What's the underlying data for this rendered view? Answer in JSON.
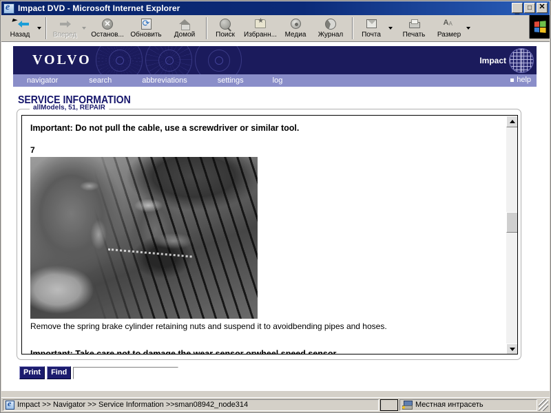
{
  "window": {
    "title": "Impact DVD - Microsoft Internet Explorer",
    "icon": "ie-icon",
    "minimize_label": "_",
    "maximize_label": "□",
    "close_label": "✕"
  },
  "toolbar": {
    "items": [
      {
        "label": "Назад",
        "icon": "back-arrow-icon",
        "disabled": false,
        "has_dropdown": true
      },
      {
        "label": "Вперед",
        "icon": "forward-arrow-icon",
        "disabled": true,
        "has_dropdown": true
      },
      {
        "label": "Останов...",
        "icon": "stop-icon",
        "disabled": false,
        "has_dropdown": false
      },
      {
        "label": "Обновить",
        "icon": "refresh-icon",
        "disabled": false,
        "has_dropdown": false
      },
      {
        "label": "Домой",
        "icon": "home-icon",
        "disabled": false,
        "has_dropdown": false
      },
      {
        "label": "Поиск",
        "icon": "search-icon",
        "disabled": false,
        "has_dropdown": false
      },
      {
        "label": "Избранн...",
        "icon": "favorites-icon",
        "disabled": false,
        "has_dropdown": false
      },
      {
        "label": "Медиа",
        "icon": "media-icon",
        "disabled": false,
        "has_dropdown": false
      },
      {
        "label": "Журнал",
        "icon": "history-icon",
        "disabled": false,
        "has_dropdown": false
      },
      {
        "label": "Почта",
        "icon": "mail-icon",
        "disabled": false,
        "has_dropdown": true
      },
      {
        "label": "Печать",
        "icon": "printer-icon",
        "disabled": false,
        "has_dropdown": false
      },
      {
        "label": "Размер",
        "icon": "font-size-icon",
        "disabled": false,
        "has_dropdown": true
      }
    ],
    "brand_logo": "windows-logo-icon"
  },
  "banner": {
    "logo_text": "VOLVO",
    "product_text": "Impact",
    "product_icon": "globe-grid-icon",
    "nav": [
      {
        "label": "navigator"
      },
      {
        "label": "search"
      },
      {
        "label": "abbreviations"
      },
      {
        "label": "settings"
      },
      {
        "label": "log"
      }
    ],
    "help_label": "help"
  },
  "page": {
    "title": "SERVICE INFORMATION",
    "breadcrumb_legend": "allModels, 51, REPAIR"
  },
  "content": {
    "important_top": "Important: Do not pull the cable, use a screwdriver or similar tool.",
    "step_number": "7",
    "photo_alt": "brake-cylinder-photo",
    "caption": "Remove the spring brake cylinder retaining nuts and suspend it to avoidbending pipes and hoses.",
    "important_bottom": "Important: Take care not to damage the wear sensor orwheel speed sensor."
  },
  "actions": {
    "print_label": "Print",
    "find_label": "Find",
    "find_value": "",
    "find_placeholder": ""
  },
  "statusbar": {
    "breadcrumb": "Impact >> Navigator >> Service Information >>sman08942_node314",
    "zone": "Местная интрасеть",
    "zone_icon": "network-zone-icon"
  },
  "colors": {
    "volvo_navy": "#1b1b5c",
    "nav_periwinkle": "#8a8ec9",
    "title_navy": "#15156b",
    "titlebar_blue": "#0a246a",
    "button_navy": "#1b1b6e"
  },
  "scrollbar": {
    "up_label": "▲",
    "down_label": "▼"
  }
}
